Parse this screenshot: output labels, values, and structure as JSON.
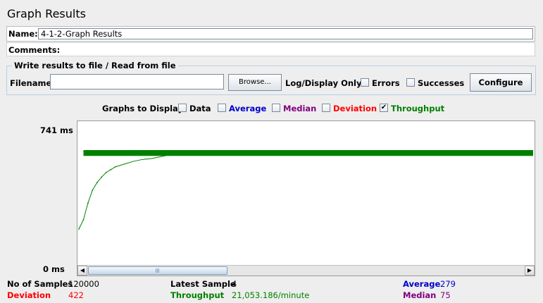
{
  "title": "Graph Results",
  "name_label": "Name:",
  "name_value": "4-1-2-Graph Results",
  "comments_label": "Comments:",
  "file_group_title": "Write results to file / Read from file",
  "filename_label": "Filename",
  "browse_label": "Browse...",
  "log_display_label": "Log/Display Only:",
  "errors_label": "Errors",
  "successes_label": "Successes",
  "configure_label": "Configure",
  "graphs_to_display_label": "Graphs to Display",
  "graph_options": [
    {
      "label": "Data",
      "checked": false,
      "color": "#000000"
    },
    {
      "label": "Average",
      "checked": false,
      "color": "#0000cc"
    },
    {
      "label": "Median",
      "checked": false,
      "color": "#800080"
    },
    {
      "label": "Deviation",
      "checked": false,
      "color": "#ff0000"
    },
    {
      "label": "Throughput",
      "checked": true,
      "color": "#008000"
    }
  ],
  "y_max_label": "741  ms",
  "y_min_label": "0  ms",
  "colors": {
    "throughput": "#008000",
    "average": "#0000cc",
    "median": "#800080",
    "deviation": "#ff0000",
    "border": "#b8cfe5"
  },
  "stats": {
    "samples_label": "No of Samples",
    "samples_value": "120000",
    "latest_label": "Latest Sample",
    "latest_value": "4",
    "average_label": "Average",
    "average_value": "279",
    "deviation_label": "Deviation",
    "deviation_value": "422",
    "throughput_label": "Throughput",
    "throughput_value": "21,053.186/minute",
    "median_label": "Median",
    "median_value": "75"
  },
  "chart_data": {
    "type": "line",
    "ylim": [
      0,
      741
    ],
    "series": [
      {
        "name": "Throughput",
        "color": "#008000",
        "x": [
          0,
          1,
          2,
          3,
          4,
          5,
          6,
          7,
          8,
          10,
          12,
          14,
          16,
          18,
          20,
          25,
          30,
          40,
          60,
          100
        ],
        "values": [
          190,
          240,
          330,
          400,
          440,
          470,
          495,
          510,
          525,
          540,
          555,
          565,
          570,
          580,
          590,
          600,
          602,
          600,
          598,
          597
        ]
      }
    ]
  }
}
